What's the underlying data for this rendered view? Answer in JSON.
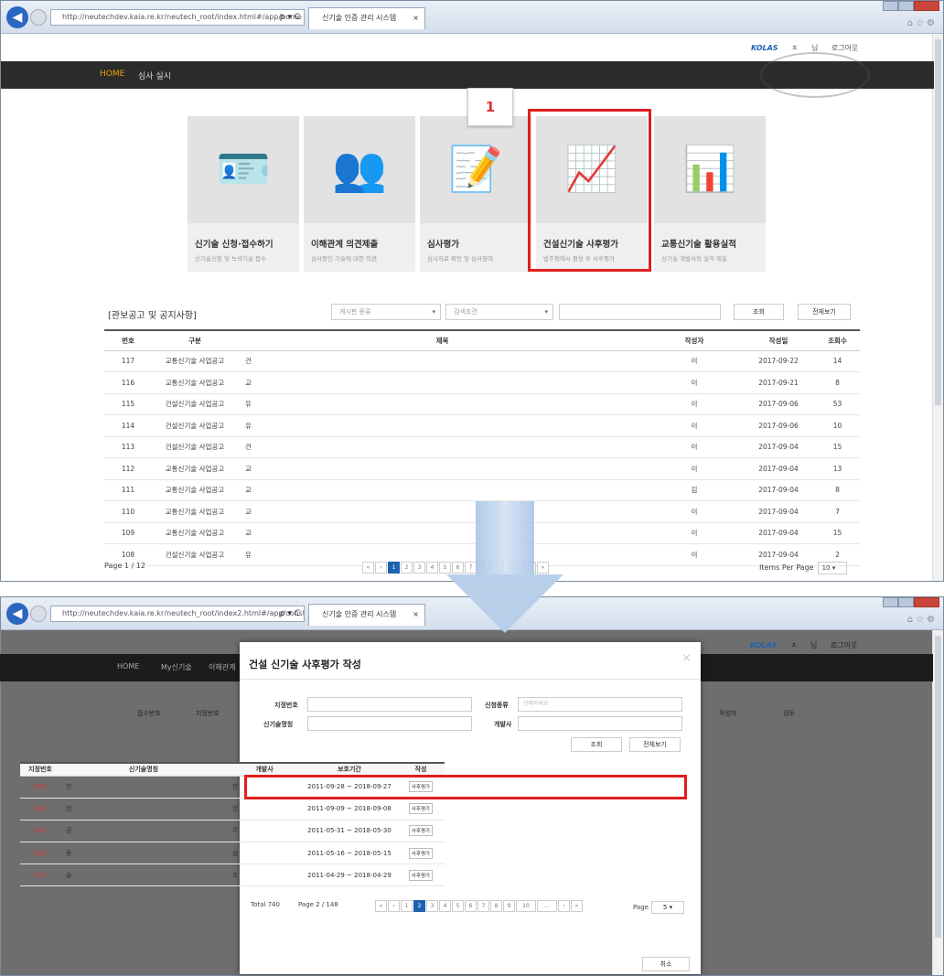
{
  "browser1": {
    "url": "http://neutechdev.kaia.re.kr/neutech_root/index.html#/app/home",
    "tab_title": "신기술 인증 관리 시스템",
    "tab_close": "×",
    "addr_ctl": "ρ ▾ C"
  },
  "utility": {
    "logo": "KOLAS",
    "item1": "ㅊ",
    "item2": "님",
    "logout": "로그아웃"
  },
  "gnb": {
    "home": "HOME",
    "menu2": "심사 실시"
  },
  "cards": [
    {
      "icon": "id-card-icon",
      "glyph": "🪪",
      "title": "신기술 신청·접수하기",
      "subtitle": "신기술신청 및 녹색기술 접수"
    },
    {
      "icon": "people-network-icon",
      "glyph": "👥",
      "title": "이해관계 의견제출",
      "subtitle": "심사중인 기술에 대한 의견"
    },
    {
      "icon": "document-edit-icon",
      "glyph": "📝",
      "title": "심사평가",
      "subtitle": "심사자료 확인 및 심사참여"
    },
    {
      "icon": "presentation-icon",
      "glyph": "📈",
      "title": "건설신기술 사후평가",
      "subtitle": "발주청에서 활용 후 사후평가"
    },
    {
      "icon": "growth-people-icon",
      "glyph": "📊",
      "title": "교통신기술 활용실적",
      "subtitle": "신기술 개발사의 실적 제출"
    }
  ],
  "step_marker": "1",
  "notice": {
    "title": "[관보공고 및 공지사항]",
    "select1": "게시판 종류",
    "select2": "검색조건",
    "search_btn": "조회",
    "all_btn": "전체보기",
    "columns": [
      "번호",
      "구분",
      "제목",
      "작성자",
      "작성일",
      "조회수"
    ],
    "rows": [
      {
        "no": "117",
        "type": "교통신기술 사업공고",
        "title": "건",
        "author": "이",
        "date": "2017-09-22",
        "views": "14"
      },
      {
        "no": "116",
        "type": "교통신기술 사업공고",
        "title": "교",
        "author": "이",
        "date": "2017-09-21",
        "views": "8"
      },
      {
        "no": "115",
        "type": "건설신기술 사업공고",
        "title": "유",
        "author": "이",
        "date": "2017-09-06",
        "views": "53"
      },
      {
        "no": "114",
        "type": "건설신기술 사업공고",
        "title": "유",
        "author": "이",
        "date": "2017-09-06",
        "views": "10"
      },
      {
        "no": "113",
        "type": "건설신기술 사업공고",
        "title": "건",
        "author": "이",
        "date": "2017-09-04",
        "views": "15"
      },
      {
        "no": "112",
        "type": "교통신기술 사업공고",
        "title": "교",
        "author": "이",
        "date": "2017-09-04",
        "views": "13"
      },
      {
        "no": "111",
        "type": "교통신기술 사업공고",
        "title": "교",
        "author": "김",
        "date": "2017-09-04",
        "views": "8"
      },
      {
        "no": "110",
        "type": "교통신기술 사업공고",
        "title": "교",
        "author": "이",
        "date": "2017-09-04",
        "views": "7"
      },
      {
        "no": "109",
        "type": "교통신기술 사업공고",
        "title": "교",
        "author": "이",
        "date": "2017-09-04",
        "views": "15"
      },
      {
        "no": "108",
        "type": "건설신기술 사업공고",
        "title": "유",
        "author": "이",
        "date": "2017-09-04",
        "views": "2"
      }
    ],
    "page_info": "Page  1 / 12",
    "pager": [
      "«",
      "‹",
      "1",
      "2",
      "3",
      "4",
      "5",
      "6",
      "7",
      "8",
      "9",
      "10",
      "›",
      "»"
    ],
    "items_per_page_label": "Items Per Page",
    "items_per_page": "10  ▾"
  },
  "browser2": {
    "url": "http://neutechdev.kaia.re.kr/neutech_root/index2.html#/app/construction/write",
    "tab_title": "신기술 인증 관리 시스템",
    "tab_close": "×",
    "addr_ctl": "ρ ▾ C"
  },
  "dim_gnb": {
    "home": "HOME",
    "menu2": "My신기술",
    "menu3": "이해관계"
  },
  "dim_head": {
    "c1": "접수번호",
    "c2": "지정번호",
    "c3": "작성자",
    "c4": "검토"
  },
  "modal": {
    "title": "건설 신기술 사후평가 작성",
    "close": "×",
    "label_no": "지정번호",
    "label_name": "신기술명칭",
    "label_type": "신청종류",
    "type_placeholder": "선택하세요",
    "label_dev": "개발사",
    "search_btn": "조회",
    "all_btn": "전체보기",
    "columns": [
      "지정번호",
      "신기술명칭",
      "개발사",
      "보호기간",
      "작성"
    ],
    "rows": [
      {
        "no": "625",
        "name": "방",
        "dev": "한",
        "period": "2011-09-28 ~ 2018-09-27",
        "action": "사후평가"
      },
      {
        "no": "624",
        "name": "현",
        "dev": "한",
        "period": "2011-09-09 ~ 2018-09-08",
        "action": "사후평가"
      },
      {
        "no": "623",
        "name": "공",
        "dev": "주",
        "period": "2011-05-31 ~ 2018-05-30",
        "action": "사후평가"
      },
      {
        "no": "622",
        "name": "동",
        "dev": "삼",
        "period": "2011-05-16 ~ 2018-05-15",
        "action": "사후평가"
      },
      {
        "no": "621",
        "name": "슬",
        "dev": "조",
        "period": "2011-04-29 ~ 2018-04-29",
        "action": "사후평가"
      }
    ],
    "total": "Total 740",
    "page": "Page 2 / 148",
    "pager": [
      "«",
      "‹",
      "1",
      "2",
      "3",
      "4",
      "5",
      "6",
      "7",
      "8",
      "9",
      "10",
      "...",
      "›",
      "»"
    ],
    "page_label": "Page",
    "page_size": "5  ▾",
    "cancel": "취소"
  },
  "colors": {
    "accent": "#1e62b0",
    "highlight": "#e01e1e",
    "nav_bg": "#2b2b2b",
    "active_menu": "#e8a200"
  }
}
